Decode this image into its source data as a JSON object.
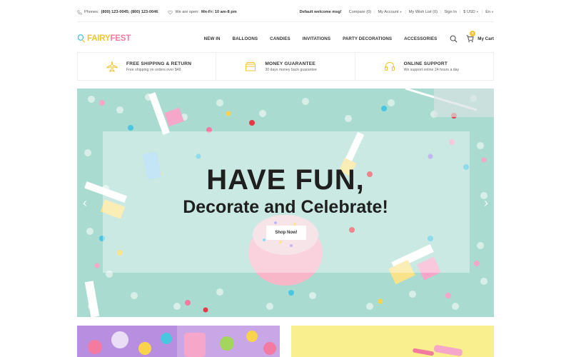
{
  "topbar": {
    "phones_label": "Phones:",
    "phones_value": "(800) 123-0045; (800) 123-0046",
    "open_label": "We are open:",
    "open_value": "Mn-Fr: 10 am-8 pm",
    "welcome": "Default welcome msg!",
    "links": {
      "compare": "Compare (0)",
      "account": "My Account",
      "wishlist": "My Wish List (0)",
      "signin": "Sign In",
      "currency": "$ USD",
      "language": "En"
    }
  },
  "header": {
    "logo": {
      "part1": "FAIRY",
      "part2": "FEST"
    },
    "nav": [
      "NEW IN",
      "BALLOONS",
      "CANDIES",
      "INVITATIONS",
      "PARTY DECORATIONS",
      "ACCESSORIES"
    ],
    "cart_label": "My Cart",
    "cart_count": "0"
  },
  "features": [
    {
      "title": "FREE SHIPPING & RETURN",
      "sub": "Free shipping on orders over $49",
      "icon": "airplane-icon"
    },
    {
      "title": "MONEY GUARANTEE",
      "sub": "30 days money back guarantee",
      "icon": "money-icon"
    },
    {
      "title": "ONLINE SUPPORT",
      "sub": "We support online 24 hours a day",
      "icon": "headset-icon"
    }
  ],
  "hero": {
    "headline": "HAVE FUN,",
    "subheadline": "Decorate and Celebrate!",
    "button": "Shop Now!",
    "prev": "‹",
    "next": "›"
  },
  "colors": {
    "accent": "#f2c530",
    "hero_bg": "#a9dbd0",
    "tile_left": "#c9a6e6",
    "tile_right": "#f9ef8e"
  }
}
